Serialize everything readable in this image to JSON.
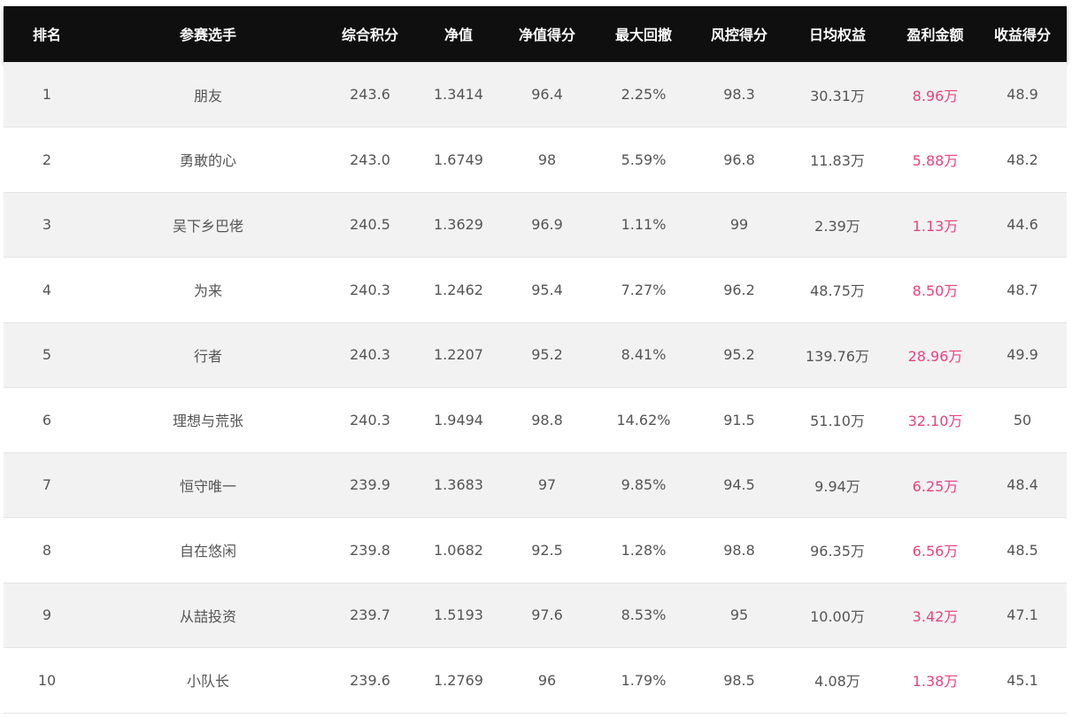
{
  "table": {
    "headers": [
      "排名",
      "参赛选手",
      "综合积分",
      "净值",
      "净值得分",
      "最大回撤",
      "风控得分",
      "日均权益",
      "盈利金额",
      "收益得分"
    ],
    "rows": [
      [
        "1",
        "朋友",
        "243.6",
        "1.3414",
        "96.4",
        "2.25%",
        "98.3",
        "30.31万",
        "8.96万",
        "48.9"
      ],
      [
        "2",
        "勇敢的心",
        "243.0",
        "1.6749",
        "98",
        "5.59%",
        "96.8",
        "11.83万",
        "5.88万",
        "48.2"
      ],
      [
        "3",
        "吴下乡巴佬",
        "240.5",
        "1.3629",
        "96.9",
        "1.11%",
        "99",
        "2.39万",
        "1.13万",
        "44.6"
      ],
      [
        "4",
        "为来",
        "240.3",
        "1.2462",
        "95.4",
        "7.27%",
        "96.2",
        "48.75万",
        "8.50万",
        "48.7"
      ],
      [
        "5",
        "行者",
        "240.3",
        "1.2207",
        "95.2",
        "8.41%",
        "95.2",
        "139.76万",
        "28.96万",
        "49.9"
      ],
      [
        "6",
        "理想与荒张",
        "240.3",
        "1.9494",
        "98.8",
        "14.62%",
        "91.5",
        "51.10万",
        "32.10万",
        "50"
      ],
      [
        "7",
        "恒守唯一",
        "239.9",
        "1.3683",
        "97",
        "9.85%",
        "94.5",
        "9.94万",
        "6.25万",
        "48.4"
      ],
      [
        "8",
        "自在悠闲",
        "239.8",
        "1.0682",
        "92.5",
        "1.28%",
        "98.8",
        "96.35万",
        "6.56万",
        "48.5"
      ],
      [
        "9",
        "从喆投资",
        "239.7",
        "1.5193",
        "97.6",
        "8.53%",
        "95",
        "10.00万",
        "3.42万",
        "47.1"
      ],
      [
        "10",
        "小队长",
        "239.6",
        "1.2769",
        "96",
        "1.79%",
        "98.5",
        "4.08万",
        "1.38万",
        "45.1"
      ]
    ]
  },
  "colors": {
    "header_bg": "#0f0f0f",
    "profit_text": "#e8437d",
    "row_alt_bg": "#f2f2f2"
  }
}
